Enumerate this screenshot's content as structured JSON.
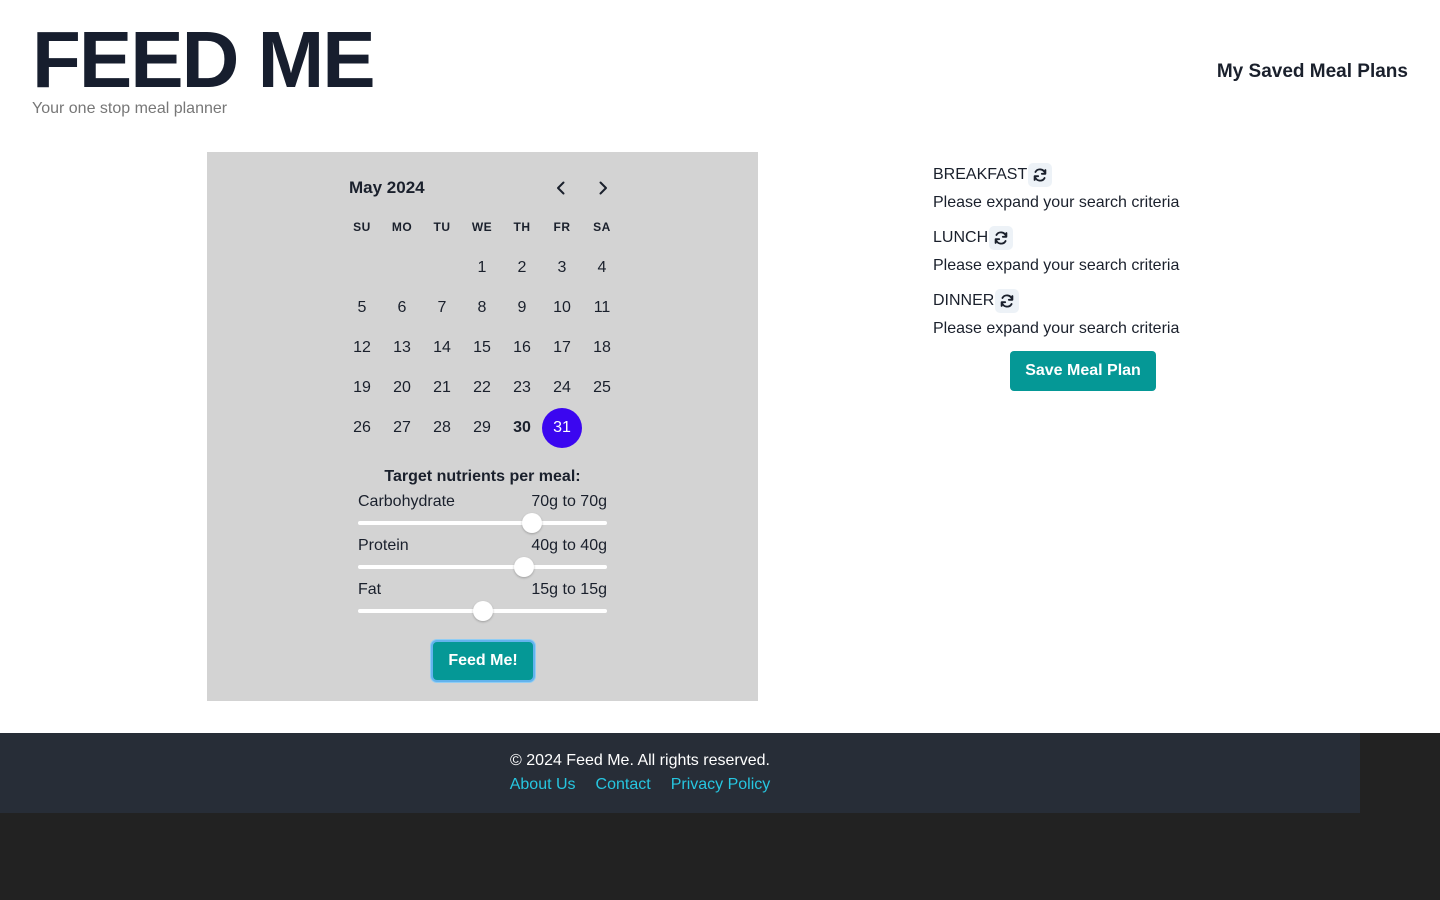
{
  "header": {
    "title": "FEED ME",
    "subtitle": "Your one stop meal planner",
    "saved_link": "My Saved Meal Plans"
  },
  "calendar": {
    "month_label": "May 2024",
    "prev_icon": "chevron-left-icon",
    "next_icon": "chevron-right-icon",
    "weekdays": [
      "SU",
      "MO",
      "TU",
      "WE",
      "TH",
      "FR",
      "SA"
    ],
    "leading_blanks": 3,
    "days": [
      "1",
      "2",
      "3",
      "4",
      "5",
      "6",
      "7",
      "8",
      "9",
      "10",
      "11",
      "12",
      "13",
      "14",
      "15",
      "16",
      "17",
      "18",
      "19",
      "20",
      "21",
      "22",
      "23",
      "24",
      "25",
      "26",
      "27",
      "28",
      "29",
      "30",
      "31"
    ],
    "today": "30",
    "selected": "31",
    "selected_color": "#3b06f0"
  },
  "nutrients": {
    "title": "Target nutrients per meal:",
    "items": [
      {
        "label": "Carbohydrate",
        "range": "70g to 70g",
        "level": 0.7
      },
      {
        "label": "Protein",
        "range": "40g to 40g",
        "level": 0.667
      },
      {
        "label": "Fat",
        "range": "15g to 15g",
        "level": 0.5
      }
    ]
  },
  "feed_button": "Feed Me!",
  "meals": {
    "items": [
      {
        "name": "BREAKFAST",
        "message": "Please expand your search criteria",
        "icon": "refresh-icon"
      },
      {
        "name": "LUNCH",
        "message": "Please expand your search criteria",
        "icon": "refresh-icon"
      },
      {
        "name": "DINNER",
        "message": "Please expand your search criteria",
        "icon": "refresh-icon"
      }
    ],
    "save_button": "Save Meal Plan"
  },
  "footer": {
    "copyright": "© 2024 Feed Me. All rights reserved.",
    "links": [
      "About Us",
      "Contact",
      "Privacy Policy"
    ]
  },
  "colors": {
    "accent": "#059896",
    "selected_day": "#3b06f0",
    "footer_bg": "#272d37",
    "footer_link": "#26c6e0",
    "panel_bg": "#d3d3d3"
  }
}
